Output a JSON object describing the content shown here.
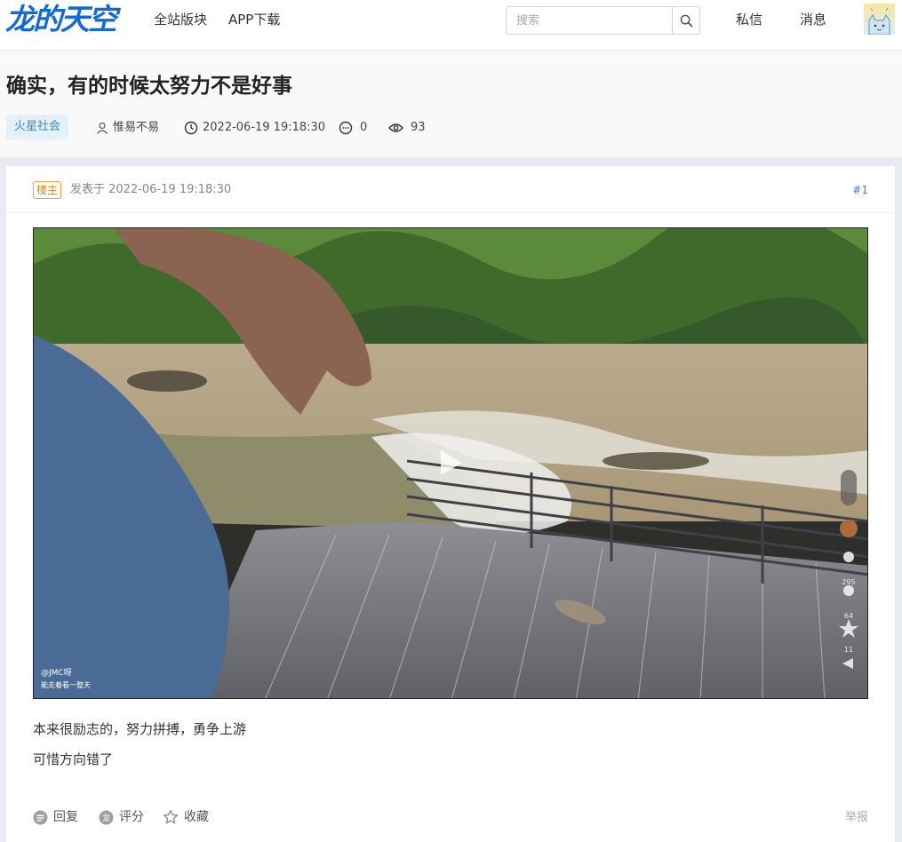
{
  "header": {
    "logo_text": "龙的天空",
    "nav": [
      "全站版块",
      "APP下载"
    ],
    "search_placeholder": "搜索",
    "messages_label": "私信",
    "notifications_label": "消息"
  },
  "thread": {
    "title": "确实，有的时候太努力不是好事",
    "tag": "火星社会",
    "author": "惟易不易",
    "datetime": "2022-06-19 19:18:30",
    "comments": "0",
    "views": "93"
  },
  "post": {
    "owner_badge": "楼主",
    "posted_at": "发表于 2022-06-19 19:18:30",
    "floor": "#1",
    "video_overlay": {
      "handle": "@JMC呀",
      "caption": "能走着看一整天",
      "side_counts": [
        "295",
        "64",
        "11"
      ]
    },
    "body": [
      "本来很励志的，努力拼搏，勇争上游",
      "可惜方向错了"
    ],
    "actions": {
      "reply": "回复",
      "rate": "评分",
      "favorite": "收藏",
      "report": "举报"
    }
  },
  "colors": {
    "brand": "#1569d6",
    "link": "#3a86d4",
    "owner_badge": "#d9882a"
  }
}
